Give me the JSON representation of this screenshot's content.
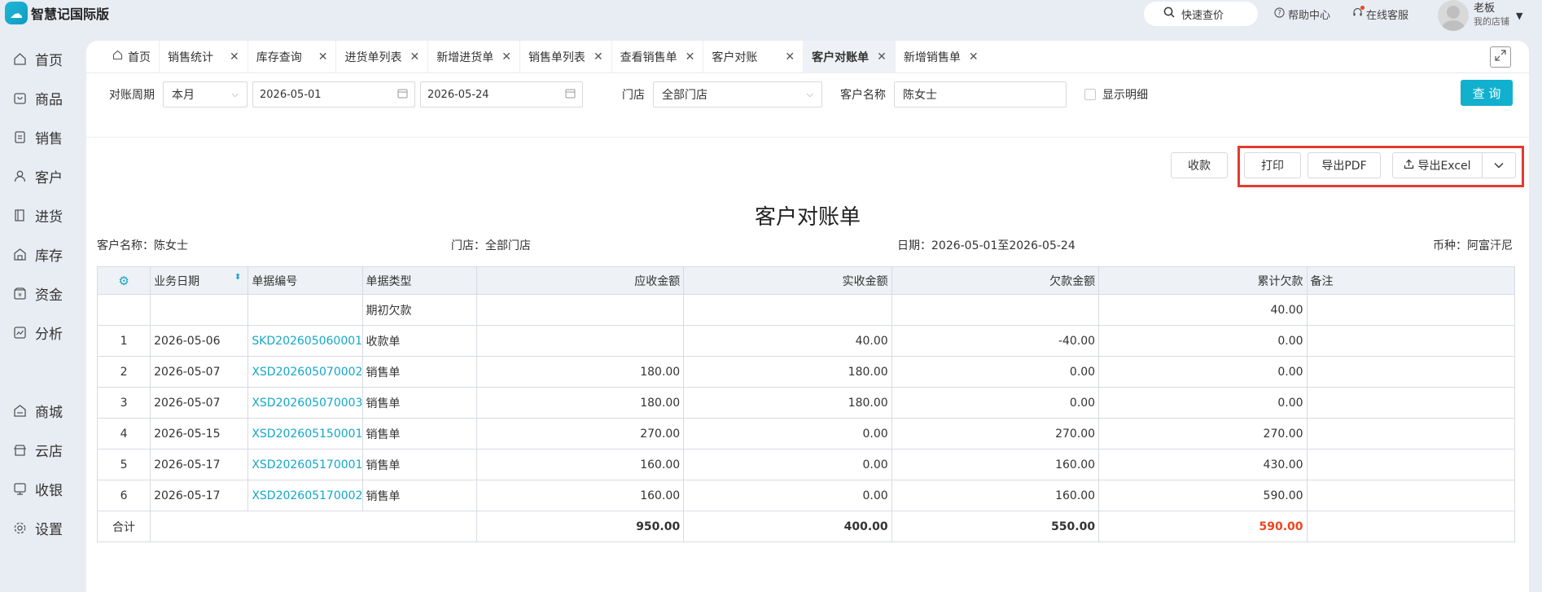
{
  "app": {
    "name": "智慧记国际版"
  },
  "topbar": {
    "quick_price": "快速查价",
    "help": "帮助中心",
    "service": "在线客服",
    "user_name": "老板",
    "user_shop": "我的店铺"
  },
  "sidebar": {
    "items": [
      {
        "label": "首页",
        "icon": "home-icon"
      },
      {
        "label": "商品",
        "icon": "goods-icon"
      },
      {
        "label": "销售",
        "icon": "sales-icon"
      },
      {
        "label": "客户",
        "icon": "customer-icon"
      },
      {
        "label": "进货",
        "icon": "purchase-icon"
      },
      {
        "label": "库存",
        "icon": "inventory-icon"
      },
      {
        "label": "资金",
        "icon": "funds-icon"
      },
      {
        "label": "分析",
        "icon": "analysis-icon"
      },
      {
        "label": "商城",
        "icon": "mall-icon"
      },
      {
        "label": "云店",
        "icon": "cloud-shop-icon"
      },
      {
        "label": "收银",
        "icon": "cashier-icon"
      },
      {
        "label": "设置",
        "icon": "settings-icon"
      }
    ]
  },
  "tabs": [
    {
      "label": "首页",
      "active": false,
      "closable": false
    },
    {
      "label": "销售统计",
      "active": false,
      "closable": true
    },
    {
      "label": "库存查询",
      "active": false,
      "closable": true
    },
    {
      "label": "进货单列表",
      "active": false,
      "closable": true
    },
    {
      "label": "新增进货单",
      "active": false,
      "closable": true
    },
    {
      "label": "销售单列表",
      "active": false,
      "closable": true
    },
    {
      "label": "查看销售单",
      "active": false,
      "closable": true
    },
    {
      "label": "客户对账",
      "active": false,
      "closable": true
    },
    {
      "label": "客户对账单",
      "active": true,
      "closable": true
    },
    {
      "label": "新增销售单",
      "active": false,
      "closable": true
    }
  ],
  "filter": {
    "period_label": "对账周期",
    "period_value": "本月",
    "date_from": "2026-05-01",
    "date_to": "2026-05-24",
    "store_label": "门店",
    "store_value": "全部门店",
    "customer_label": "客户名称",
    "customer_value": "陈女士",
    "show_detail": "显示明细",
    "query": "查 询"
  },
  "actions": {
    "receive": "收款",
    "print": "打印",
    "export_pdf": "导出PDF",
    "export_excel": "导出Excel"
  },
  "report": {
    "title": "客户对账单",
    "customer": "客户名称：陈女士",
    "store": "门店：全部门店",
    "date_range": "日期：2026-05-01至2026-05-24",
    "currency": "币种：阿富汗尼"
  },
  "table": {
    "headers": {
      "date": "业务日期",
      "doc_no": "单据编号",
      "doc_type": "单据类型",
      "receivable": "应收金额",
      "received": "实收金额",
      "owed": "欠款金额",
      "cumulative": "累计欠款",
      "remark": "备注"
    },
    "opening": {
      "doc_type": "期初欠款",
      "cumulative": "40.00"
    },
    "rows": [
      {
        "idx": "1",
        "date": "2026-05-06",
        "doc_no": "SKD202605060001",
        "doc_type": "收款单",
        "receivable": "",
        "received": "40.00",
        "owed": "-40.00",
        "cumulative": "0.00"
      },
      {
        "idx": "2",
        "date": "2026-05-07",
        "doc_no": "XSD202605070002",
        "doc_type": "销售单",
        "receivable": "180.00",
        "received": "180.00",
        "owed": "0.00",
        "cumulative": "0.00"
      },
      {
        "idx": "3",
        "date": "2026-05-07",
        "doc_no": "XSD202605070003",
        "doc_type": "销售单",
        "receivable": "180.00",
        "received": "180.00",
        "owed": "0.00",
        "cumulative": "0.00"
      },
      {
        "idx": "4",
        "date": "2026-05-15",
        "doc_no": "XSD202605150001",
        "doc_type": "销售单",
        "receivable": "270.00",
        "received": "0.00",
        "owed": "270.00",
        "cumulative": "270.00"
      },
      {
        "idx": "5",
        "date": "2026-05-17",
        "doc_no": "XSD202605170001",
        "doc_type": "销售单",
        "receivable": "160.00",
        "received": "0.00",
        "owed": "160.00",
        "cumulative": "430.00"
      },
      {
        "idx": "6",
        "date": "2026-05-17",
        "doc_no": "XSD202605170002",
        "doc_type": "销售单",
        "receivable": "160.00",
        "received": "0.00",
        "owed": "160.00",
        "cumulative": "590.00"
      }
    ],
    "total": {
      "label": "合计",
      "receivable": "950.00",
      "received": "400.00",
      "owed": "550.00",
      "cumulative": "590.00"
    }
  },
  "colors": {
    "accent": "#12b0cf",
    "highlight": "#e33b2e",
    "total_red": "#f0441d"
  }
}
